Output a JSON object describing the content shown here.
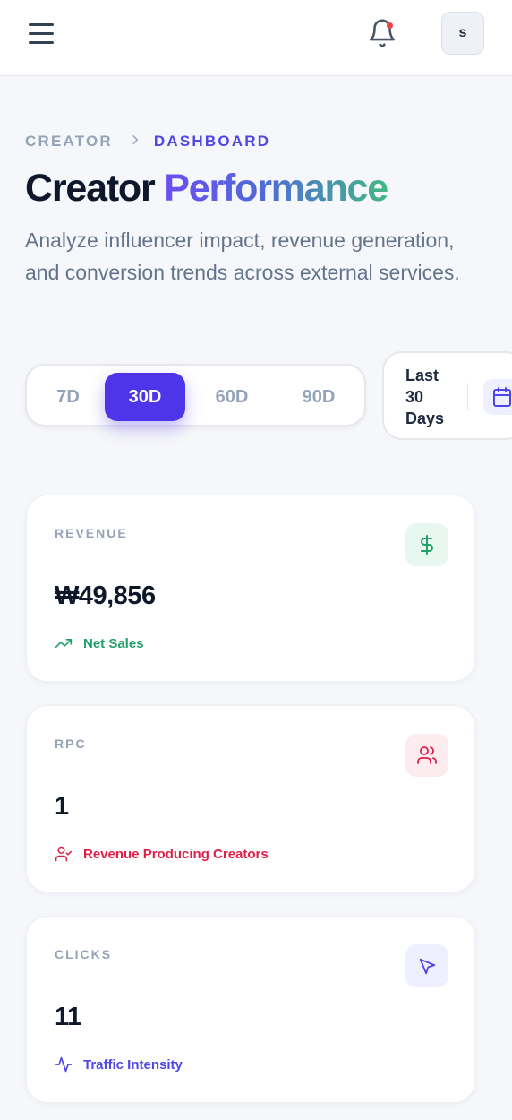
{
  "header": {
    "avatar_initial": "s",
    "has_notification": true
  },
  "breadcrumb": {
    "parent": "CREATOR",
    "current": "DASHBOARD"
  },
  "page": {
    "title_part1": "Creator",
    "title_part2": "Performance",
    "subtitle": "Analyze influencer impact, revenue generation, and conversion trends across external services."
  },
  "range_selector": {
    "options": [
      "7D",
      "30D",
      "60D",
      "90D"
    ],
    "selected": "30D",
    "date_label": "Last 30 Days"
  },
  "metrics": [
    {
      "label": "REVENUE",
      "value": "₩49,856",
      "footnote": "Net Sales",
      "icon": "dollar-icon",
      "accent": "#22a06b",
      "icon_bg": "#e8f7ef"
    },
    {
      "label": "RPC",
      "value": "1",
      "footnote": "Revenue Producing Creators",
      "icon": "users-icon",
      "accent": "#e11d48",
      "icon_bg": "#fdecef"
    },
    {
      "label": "CLICKS",
      "value": "11",
      "footnote": "Traffic Intensity",
      "icon": "cursor-icon",
      "accent": "#4f46e5",
      "icon_bg": "#eef0ff"
    }
  ],
  "colors": {
    "primary": "#4f35ea",
    "background": "#f6f7fa"
  }
}
